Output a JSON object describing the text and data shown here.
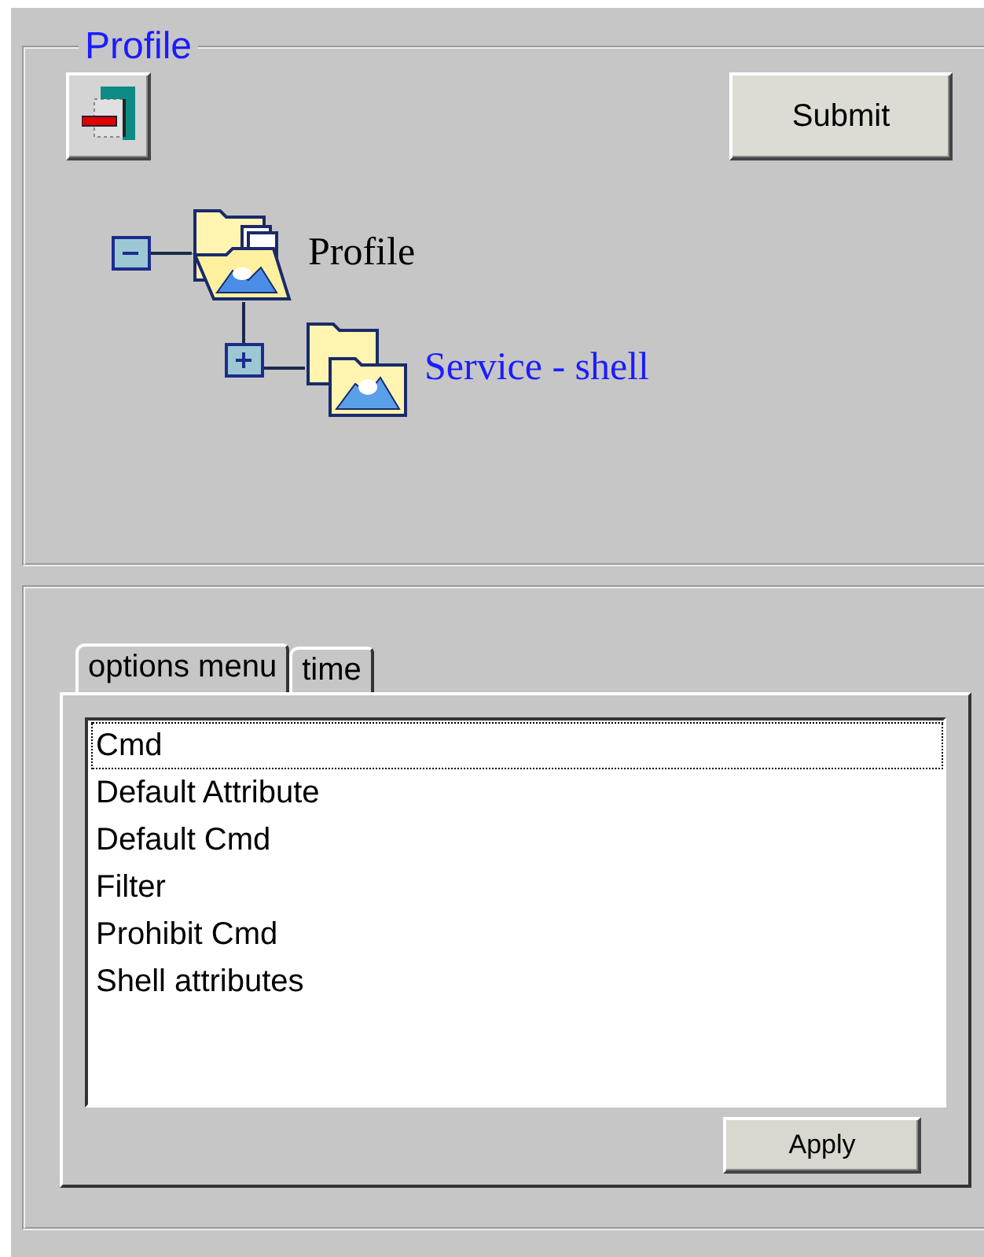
{
  "profile_panel": {
    "title": "Profile",
    "submit_button": "Submit"
  },
  "tree": [
    {
      "label": "Profile",
      "expanded": true,
      "selected": false,
      "children": [
        {
          "label": "Service - shell",
          "expanded": false,
          "selected": true
        }
      ]
    }
  ],
  "tabs": [
    {
      "label": "options menu",
      "selected": true
    },
    {
      "label": "time",
      "selected": false
    }
  ],
  "options_list": [
    {
      "label": "Cmd",
      "selected": true
    },
    {
      "label": "Default Attribute",
      "selected": false
    },
    {
      "label": "Default Cmd",
      "selected": false
    },
    {
      "label": "Filter",
      "selected": false
    },
    {
      "label": "Prohibit Cmd",
      "selected": false
    },
    {
      "label": "Shell attributes",
      "selected": false
    }
  ],
  "apply_button": "Apply"
}
